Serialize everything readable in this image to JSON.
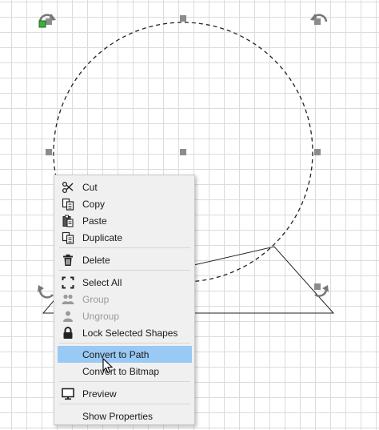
{
  "context_menu": {
    "items": [
      {
        "label": "Cut",
        "icon": "scissors-icon",
        "enabled": true
      },
      {
        "label": "Copy",
        "icon": "copy-icon",
        "enabled": true
      },
      {
        "label": "Paste",
        "icon": "paste-icon",
        "enabled": true
      },
      {
        "label": "Duplicate",
        "icon": "duplicate-icon",
        "enabled": true
      },
      {
        "label": "Delete",
        "icon": "trash-icon",
        "enabled": true
      },
      {
        "label": "Select All",
        "icon": "select-all-icon",
        "enabled": true
      },
      {
        "label": "Group",
        "icon": "group-icon",
        "enabled": false
      },
      {
        "label": "Ungroup",
        "icon": "ungroup-icon",
        "enabled": false
      },
      {
        "label": "Lock Selected Shapes",
        "icon": "lock-icon",
        "enabled": true
      },
      {
        "label": "Convert to Path",
        "icon": "",
        "enabled": true,
        "highlighted": true
      },
      {
        "label": "Convert to Bitmap",
        "icon": "",
        "enabled": true
      },
      {
        "label": "Preview",
        "icon": "monitor-icon",
        "enabled": true
      },
      {
        "label": "Show Properties",
        "icon": "",
        "enabled": true
      }
    ]
  },
  "colors": {
    "highlight": "#99c9f5",
    "grid": "#dcdcdc",
    "handle": "#8c8c8c",
    "lock_badge": "#3cae3c"
  }
}
